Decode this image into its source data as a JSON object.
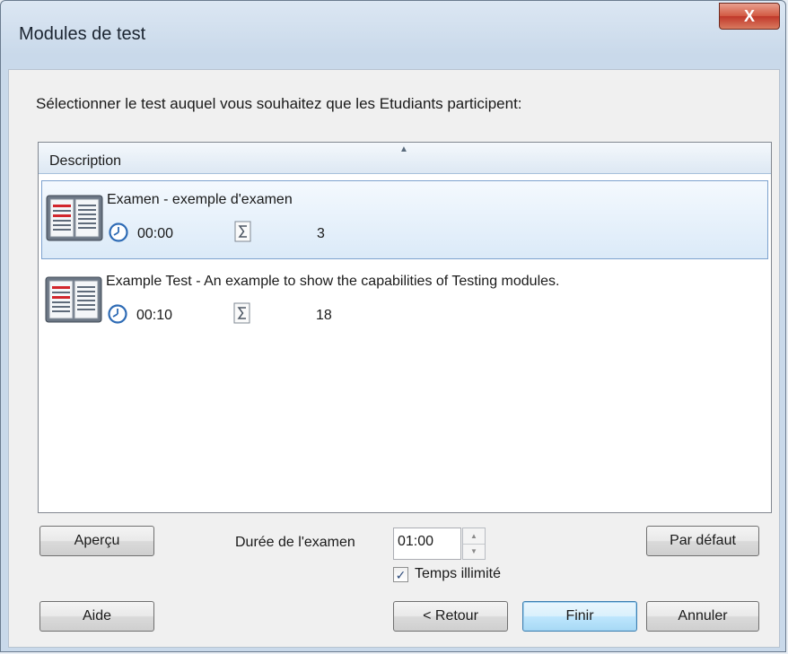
{
  "window": {
    "title": "Modules de test",
    "close_glyph": "X"
  },
  "instruction": "Sélectionner le test auquel vous souhaitez que les Etudiants participent:",
  "list": {
    "column_header": "Description",
    "rows": [
      {
        "title": "Examen - exemple d'examen",
        "duration": "00:00",
        "count": "3",
        "selected": true
      },
      {
        "title": "Example Test - An example to show the capabilities of Testing modules.",
        "duration": "00:10",
        "count": "18",
        "selected": false
      }
    ]
  },
  "buttons": {
    "apercu": "Aperçu",
    "par_defaut": "Par défaut",
    "aide": "Aide",
    "retour": "< Retour",
    "finir": "Finir",
    "annuler": "Annuler"
  },
  "duration": {
    "label": "Durée de l'examen",
    "value": "01:00"
  },
  "unlimited": {
    "label": "Temps illimité",
    "checked": true
  },
  "icons": {
    "row_icon": "book-icon",
    "clock": "clock-icon",
    "sum": "sigma-icon",
    "sort": "sort-up-icon",
    "spin_up": "spin-up-icon",
    "spin_down": "spin-down-icon"
  },
  "colors": {
    "selection": "#dbeaf8",
    "selection_border": "#7da2ce",
    "default_button": "#3c7fb1",
    "close_button": "#c0382a"
  }
}
